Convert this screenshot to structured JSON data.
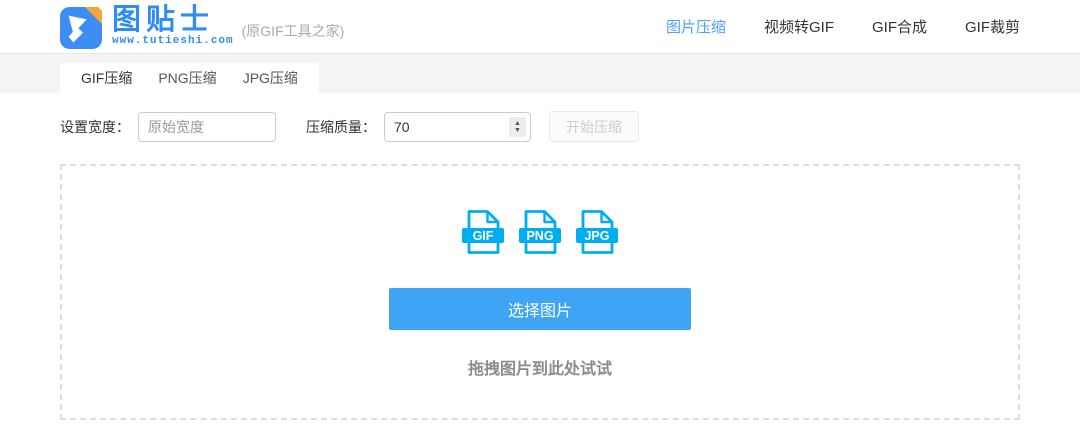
{
  "header": {
    "logo": {
      "wordmark": "图贴士",
      "domain": "www.tutieshi.com",
      "subtitle": "(原GIF工具之家)"
    },
    "nav": [
      {
        "label": "图片压缩",
        "active": true
      },
      {
        "label": "视频转GIF",
        "active": false
      },
      {
        "label": "GIF合成",
        "active": false
      },
      {
        "label": "GIF裁剪",
        "active": false
      }
    ]
  },
  "tabs": [
    {
      "label": "GIF压缩",
      "active": true
    },
    {
      "label": "PNG压缩",
      "active": false
    },
    {
      "label": "JPG压缩",
      "active": false
    }
  ],
  "form": {
    "width_label": "设置宽度：",
    "width_placeholder": "原始宽度",
    "quality_label": "压缩质量：",
    "quality_value": "70",
    "start_button_label": "开始压缩"
  },
  "dropzone": {
    "file_icons": [
      "GIF",
      "PNG",
      "JPG"
    ],
    "select_button_label": "选择图片",
    "drag_hint": "拖拽图片到此处试试"
  },
  "colors": {
    "accent_blue": "#3da4f6",
    "icon_cyan": "#00aeef",
    "logo_blue": "#2f8df4",
    "logo_orange": "#f7a63c",
    "nav_active_blue": "#4da1f7"
  }
}
